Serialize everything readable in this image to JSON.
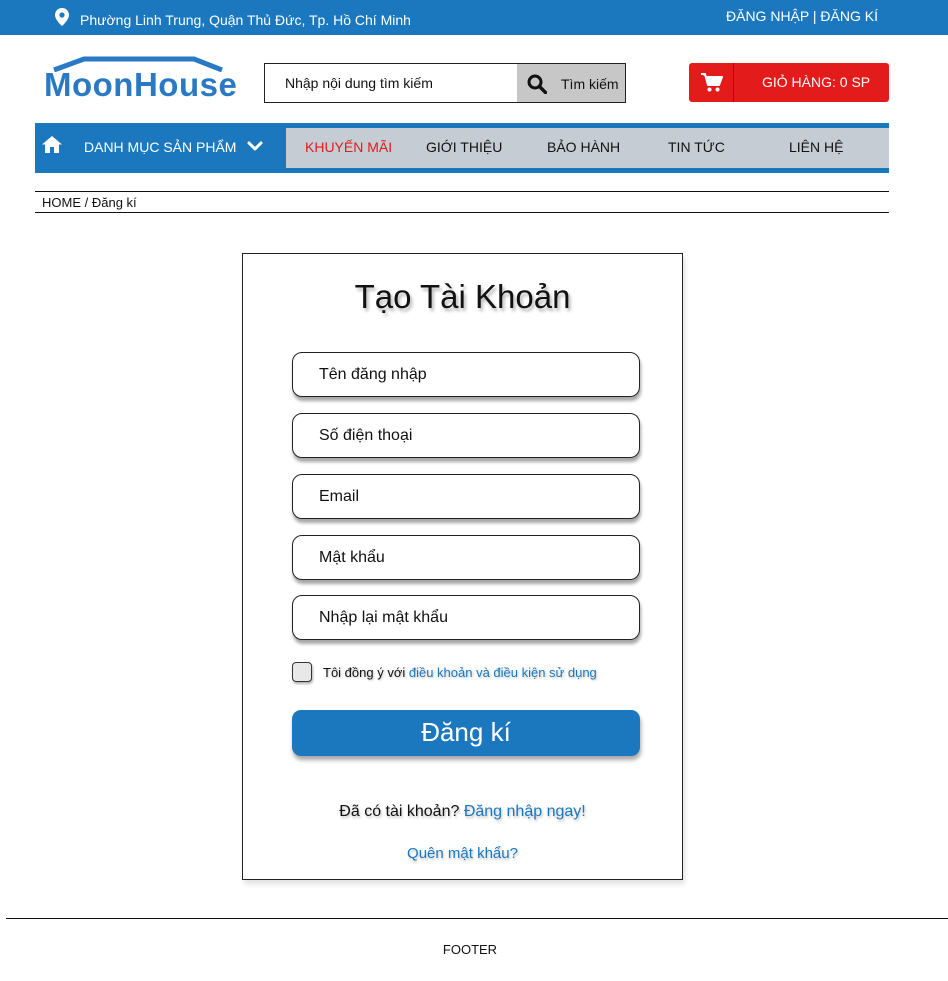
{
  "topbar": {
    "address": "Phường Linh Trung, Quận Thủ Đức, Tp. Hồ Chí Minh",
    "login": "ĐĂNG NHẬP",
    "separator": " | ",
    "register": "ĐĂNG KÍ",
    "icon": "location-pin-icon"
  },
  "header": {
    "logo_text": "MoonHouse",
    "search_placeholder": "Nhập nội dung tìm kiếm",
    "search_button": "Tìm kiếm",
    "cart_label": "GIỎ HÀNG: 0 SP"
  },
  "nav": {
    "category_label": "DANH MỤC SẢN PHẨM",
    "items": [
      {
        "label": "KHUYẾN MÃI",
        "highlight": true
      },
      {
        "label": "GIỚI THIỆU"
      },
      {
        "label": "BẢO HÀNH"
      },
      {
        "label": "TIN TỨC"
      },
      {
        "label": "LIÊN HỆ"
      }
    ]
  },
  "breadcrumb": {
    "home": "HOME",
    "separator": " / ",
    "current": "Đăng kí"
  },
  "form": {
    "title": "Tạo Tài Khoản",
    "fields": [
      {
        "placeholder": "Tên đăng nhập"
      },
      {
        "placeholder": "Số điện thoại"
      },
      {
        "placeholder": "Email"
      },
      {
        "placeholder": "Mật khẩu"
      },
      {
        "placeholder": "Nhập lại mật khẩu"
      }
    ],
    "agree_text": "Tôi đồng ý với ",
    "agree_link": "điều khoản và điều kiện sử dụng",
    "submit": "Đăng kí",
    "have_account": "Đã có tài khoản?",
    "login_link": "Đăng nhập ngay!",
    "forgot": "Quên mật khẩu?"
  },
  "footer": {
    "label": "FOOTER"
  },
  "colors": {
    "brand_blue": "#1b78bf",
    "cart_red": "#e31b1b",
    "menu_gray": "#c5ccd3"
  }
}
